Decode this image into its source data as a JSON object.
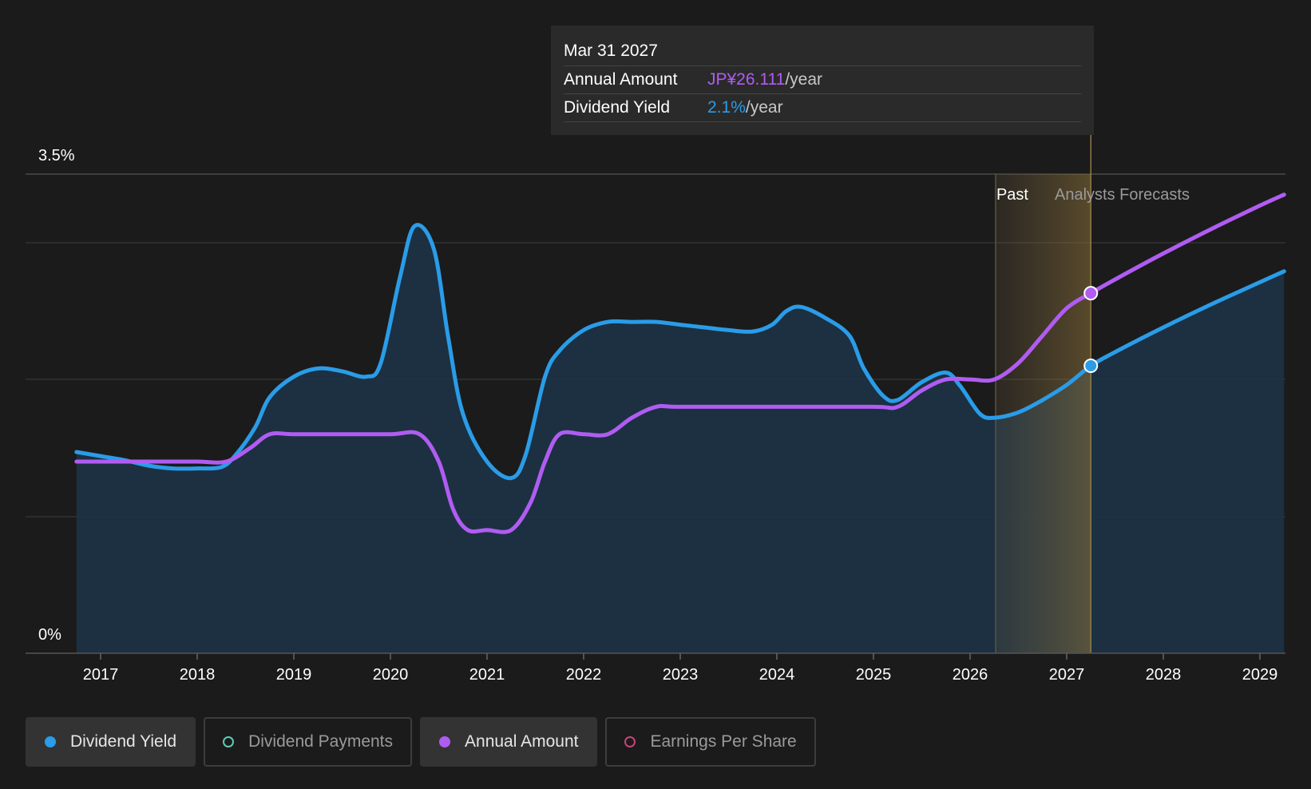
{
  "chart_data": {
    "type": "line",
    "y_axis": {
      "top_label": "3.5%",
      "bottom_label": "0%",
      "ylim": [
        0,
        3.5
      ]
    },
    "x_ticks": [
      "2017",
      "2018",
      "2019",
      "2020",
      "2021",
      "2022",
      "2023",
      "2024",
      "2025",
      "2026",
      "2027",
      "2028",
      "2029"
    ],
    "xlim": [
      2016.75,
      2029.25
    ],
    "past_label": "Past",
    "forecast_label": "Analysts Forecasts",
    "series": [
      {
        "name": "Dividend Yield",
        "color": "#2a9ce8",
        "points": [
          [
            2016.75,
            1.47
          ],
          [
            2017.0,
            1.44
          ],
          [
            2017.25,
            1.41
          ],
          [
            2017.5,
            1.37
          ],
          [
            2017.75,
            1.35
          ],
          [
            2018.0,
            1.35
          ],
          [
            2018.25,
            1.36
          ],
          [
            2018.4,
            1.45
          ],
          [
            2018.6,
            1.65
          ],
          [
            2018.75,
            1.87
          ],
          [
            2019.0,
            2.02
          ],
          [
            2019.25,
            2.08
          ],
          [
            2019.5,
            2.06
          ],
          [
            2019.75,
            2.02
          ],
          [
            2019.9,
            2.12
          ],
          [
            2020.1,
            2.75
          ],
          [
            2020.25,
            3.12
          ],
          [
            2020.45,
            2.95
          ],
          [
            2020.6,
            2.3
          ],
          [
            2020.75,
            1.75
          ],
          [
            2021.0,
            1.4
          ],
          [
            2021.25,
            1.28
          ],
          [
            2021.4,
            1.45
          ],
          [
            2021.6,
            2.02
          ],
          [
            2021.75,
            2.21
          ],
          [
            2022.0,
            2.36
          ],
          [
            2022.25,
            2.42
          ],
          [
            2022.5,
            2.42
          ],
          [
            2022.75,
            2.42
          ],
          [
            2023.0,
            2.4
          ],
          [
            2023.25,
            2.38
          ],
          [
            2023.5,
            2.36
          ],
          [
            2023.75,
            2.35
          ],
          [
            2023.95,
            2.4
          ],
          [
            2024.1,
            2.5
          ],
          [
            2024.25,
            2.53
          ],
          [
            2024.5,
            2.45
          ],
          [
            2024.75,
            2.32
          ],
          [
            2024.9,
            2.08
          ],
          [
            2025.1,
            1.88
          ],
          [
            2025.25,
            1.85
          ],
          [
            2025.5,
            1.98
          ],
          [
            2025.75,
            2.05
          ],
          [
            2025.9,
            1.95
          ],
          [
            2026.1,
            1.75
          ],
          [
            2026.25,
            1.72
          ],
          [
            2026.5,
            1.76
          ],
          [
            2026.75,
            1.85
          ],
          [
            2027.0,
            1.96
          ],
          [
            2027.25,
            2.1
          ],
          [
            2027.5,
            2.2
          ],
          [
            2028.0,
            2.38
          ],
          [
            2028.5,
            2.55
          ],
          [
            2029.0,
            2.71
          ],
          [
            2029.25,
            2.79
          ]
        ]
      },
      {
        "name": "Annual Amount",
        "color": "#b05cf2",
        "points": [
          [
            2016.75,
            1.4
          ],
          [
            2017.0,
            1.4
          ],
          [
            2017.5,
            1.4
          ],
          [
            2018.0,
            1.4
          ],
          [
            2018.3,
            1.4
          ],
          [
            2018.55,
            1.5
          ],
          [
            2018.75,
            1.6
          ],
          [
            2019.0,
            1.6
          ],
          [
            2019.5,
            1.6
          ],
          [
            2020.0,
            1.6
          ],
          [
            2020.3,
            1.6
          ],
          [
            2020.5,
            1.4
          ],
          [
            2020.65,
            1.05
          ],
          [
            2020.8,
            0.9
          ],
          [
            2021.0,
            0.9
          ],
          [
            2021.25,
            0.9
          ],
          [
            2021.45,
            1.1
          ],
          [
            2021.6,
            1.4
          ],
          [
            2021.75,
            1.6
          ],
          [
            2022.0,
            1.6
          ],
          [
            2022.25,
            1.6
          ],
          [
            2022.5,
            1.72
          ],
          [
            2022.75,
            1.8
          ],
          [
            2023.0,
            1.8
          ],
          [
            2024.0,
            1.8
          ],
          [
            2025.0,
            1.8
          ],
          [
            2025.25,
            1.8
          ],
          [
            2025.5,
            1.92
          ],
          [
            2025.75,
            2.0
          ],
          [
            2026.0,
            2.0
          ],
          [
            2026.25,
            2.0
          ],
          [
            2026.5,
            2.12
          ],
          [
            2026.75,
            2.32
          ],
          [
            2027.0,
            2.52
          ],
          [
            2027.25,
            2.63
          ],
          [
            2027.5,
            2.73
          ],
          [
            2028.0,
            2.92
          ],
          [
            2028.5,
            3.1
          ],
          [
            2029.0,
            3.27
          ],
          [
            2029.25,
            3.35
          ]
        ]
      }
    ],
    "highlight": {
      "x": 2027.25,
      "yield": 2.1,
      "amount": 2.63
    }
  },
  "tooltip": {
    "date": "Mar 31 2027",
    "row1_label": "Annual Amount",
    "row1_value": "JP¥26.111",
    "row1_unit": "/year",
    "row2_label": "Dividend Yield",
    "row2_value": "2.1%",
    "row2_unit": "/year"
  },
  "legend": [
    {
      "label": "Dividend Yield",
      "active": true,
      "color": "#2a9ce8",
      "filled": true
    },
    {
      "label": "Dividend Payments",
      "active": false,
      "color": "#5ec9b8",
      "filled": false
    },
    {
      "label": "Annual Amount",
      "active": true,
      "color": "#b05cf2",
      "filled": true
    },
    {
      "label": "Earnings Per Share",
      "active": false,
      "color": "#c4457a",
      "filled": false
    }
  ]
}
